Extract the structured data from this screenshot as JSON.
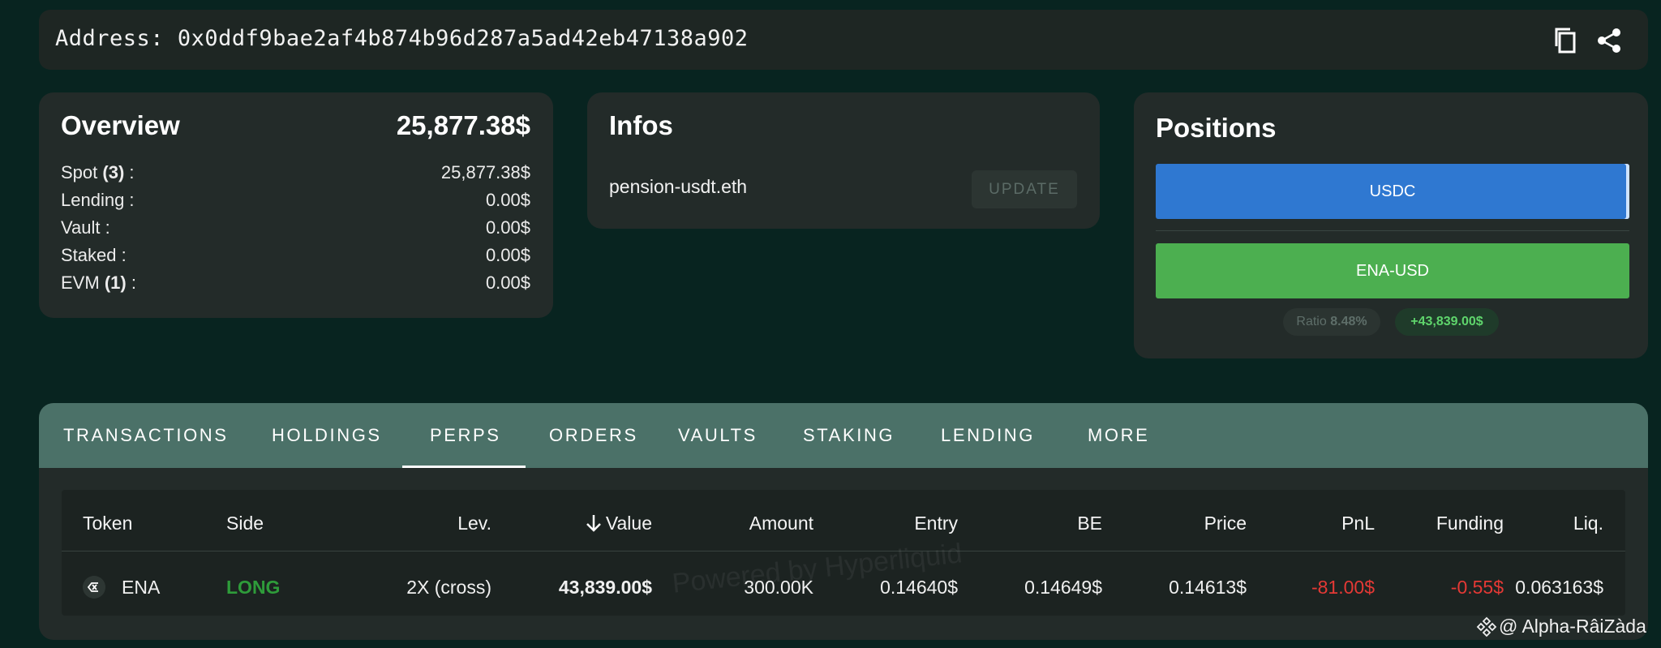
{
  "address": {
    "label": "Address:",
    "value": "0x0ddf9bae2af4b874b96d287a5ad42eb47138a902"
  },
  "overview": {
    "title": "Overview",
    "total": "25,877.38$",
    "rows": [
      {
        "label": "Spot",
        "count": "(3)",
        "suffix": ":",
        "value": "25,877.38$"
      },
      {
        "label": "Lending :",
        "value": "0.00$"
      },
      {
        "label": "Vault :",
        "value": "0.00$"
      },
      {
        "label": "Staked :",
        "value": "0.00$"
      },
      {
        "label": "EVM",
        "count": "(1)",
        "suffix": ":",
        "value": "0.00$"
      }
    ]
  },
  "infos": {
    "title": "Infos",
    "ens": "pension-usdt.eth",
    "update_label": "UPDATE"
  },
  "positions": {
    "title": "Positions",
    "bars": [
      {
        "label": "USDC",
        "color": "#2f78d1"
      },
      {
        "label": "ENA-USD",
        "color": "#4caf50"
      }
    ],
    "ratio_label": "Ratio",
    "ratio_value": "8.48%",
    "pnl": "+43,839.00$"
  },
  "tabs": [
    "TRANSACTIONS",
    "HOLDINGS",
    "PERPS",
    "ORDERS",
    "VAULTS",
    "STAKING",
    "LENDING",
    "MORE"
  ],
  "active_tab": "PERPS",
  "table": {
    "columns": [
      "Token",
      "Side",
      "Lev.",
      "Value",
      "Amount",
      "Entry",
      "BE",
      "Price",
      "PnL",
      "Funding",
      "Liq."
    ],
    "rows": [
      {
        "token": "ENA",
        "side": "LONG",
        "lev": "2X (cross)",
        "value": "43,839.00$",
        "amount": "300.00K",
        "entry": "0.14640$",
        "be": "0.14649$",
        "price": "0.14613$",
        "pnl": "-81.00$",
        "funding": "-0.55$",
        "liq": "0.063163$"
      }
    ]
  },
  "watermark": "Powered by Hyperliquid",
  "credit": "@ Alpha-RâiZàda",
  "colors": {
    "long": "#2e9c3a",
    "negative": "#e53935",
    "positive_chip": "#5fd56c"
  }
}
